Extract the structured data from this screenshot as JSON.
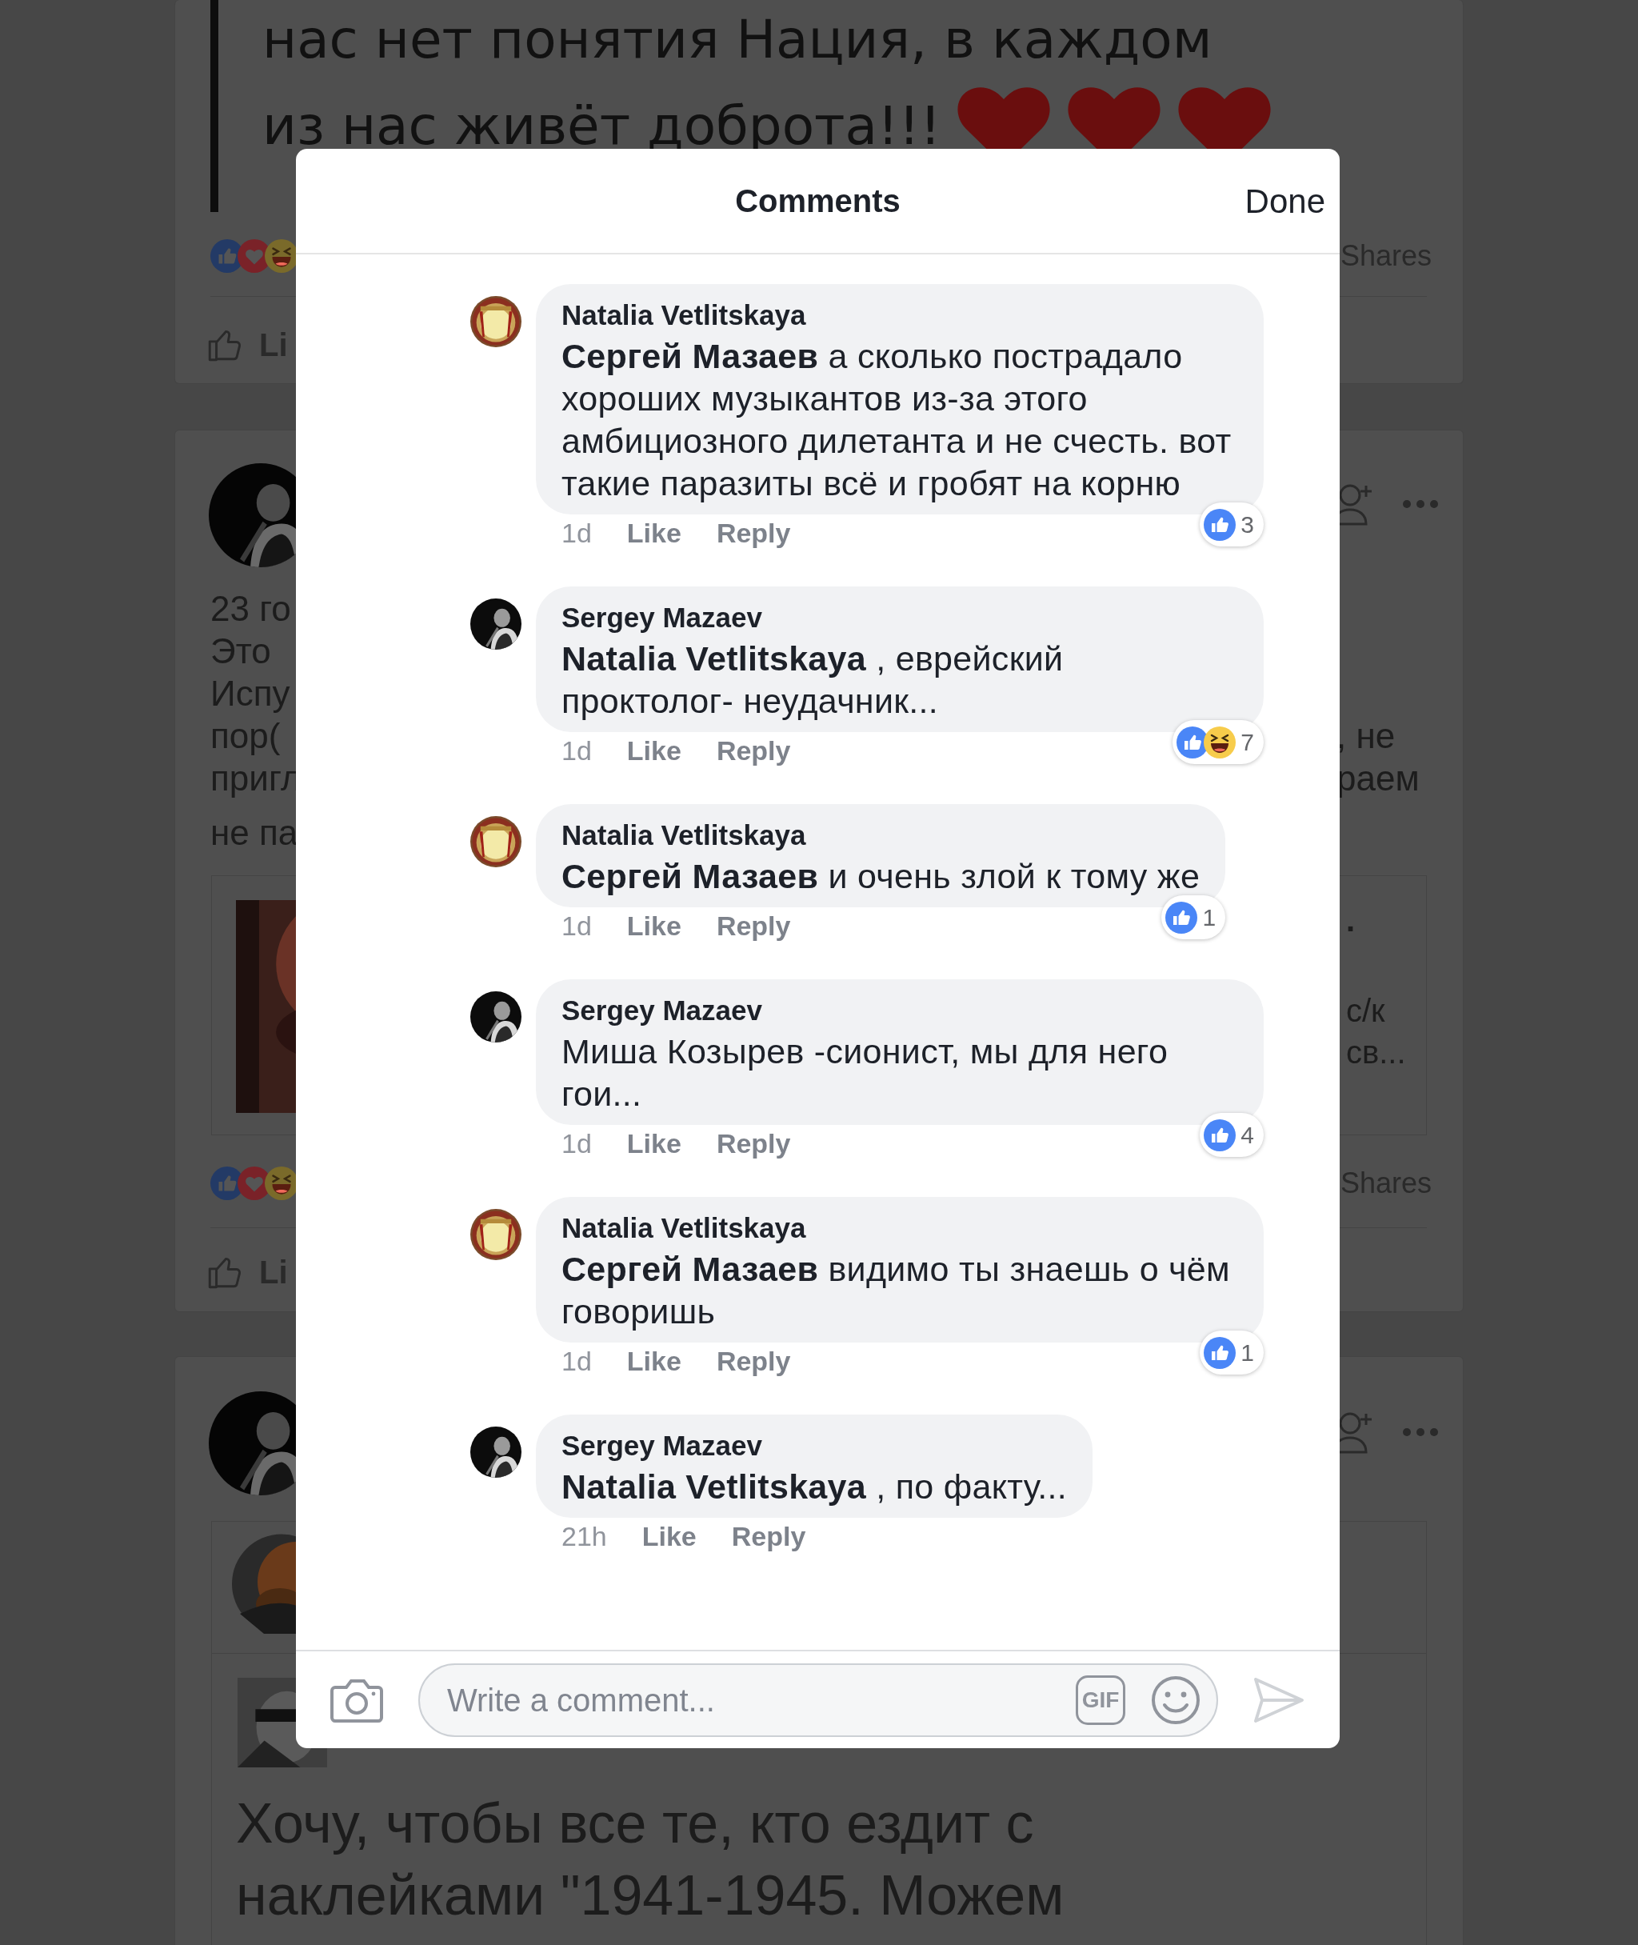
{
  "feed": {
    "posts": [
      {
        "kind": "image_text",
        "image_lines": [
          "нас нет понятия Нация, в каждом",
          "из нас живёт доброта!!!"
        ],
        "reactions": [
          {
            "kind": "like"
          },
          {
            "kind": "love"
          },
          {
            "kind": "haha"
          }
        ],
        "shares": "Shares",
        "like": "Li"
      },
      {
        "kind": "link",
        "lines": [
          {
            "left": "23 го"
          },
          {
            "left": "Это"
          },
          {
            "left": "Испу"
          },
          {
            "left": "пор(",
            "right": ", не"
          },
          {
            "left": "пригл",
            "right": "раем"
          }
        ],
        "last_line": "не па",
        "link_title": ".",
        "link_lines": [
          "с/к",
          "св..."
        ],
        "reactions": [
          {
            "kind": "like"
          },
          {
            "kind": "love"
          },
          {
            "kind": "haha"
          }
        ],
        "shares": "Shares",
        "like": "Li"
      },
      {
        "kind": "shared",
        "shared_text": "Хочу, чтобы все те, кто ездит с наклейками \"1941-1945. Можем"
      }
    ]
  },
  "dialog": {
    "title": "Comments",
    "done": "Done",
    "comments": [
      {
        "author": "Natalia Vetlitskaya",
        "text": "**Сергей Мазаев** а сколько пострадало хороших музыкантов из-за этого амбициозного дилетанта  и не счесть. вот такие паразиты всё и гробят на корню",
        "time": "1d",
        "like": "Like",
        "reply": "Reply",
        "reactions": [
          {
            "kind": "like"
          }
        ],
        "reaction_count": "3"
      },
      {
        "author": "Sergey Mazaev",
        "text": "**Natalia Vetlitskaya** , еврейский проктолог- неудачник...",
        "time": "1d",
        "like": "Like",
        "reply": "Reply",
        "reactions": [
          {
            "kind": "like"
          },
          {
            "kind": "haha"
          }
        ],
        "reaction_count": "7"
      },
      {
        "author": "Natalia Vetlitskaya",
        "text": "**Сергей Мазаев** и очень злой к тому же",
        "time": "1d",
        "like": "Like",
        "reply": "Reply",
        "reactions": [
          {
            "kind": "like"
          }
        ],
        "reaction_count": "1"
      },
      {
        "author": "Sergey Mazaev",
        "text": "Миша Козырев -сионист, мы для него гои...",
        "time": "1d",
        "like": "Like",
        "reply": "Reply",
        "reactions": [
          {
            "kind": "like"
          }
        ],
        "reaction_count": "4"
      },
      {
        "author": "Natalia Vetlitskaya",
        "text": "**Сергей Мазаев** видимо ты знаешь о чём говоришь",
        "time": "1d",
        "like": "Like",
        "reply": "Reply",
        "reactions": [
          {
            "kind": "like"
          }
        ],
        "reaction_count": "1"
      },
      {
        "author": "Sergey Mazaev",
        "text": "**Natalia Vetlitskaya** , по факту...",
        "time": "21h",
        "like": "Like",
        "reply": "Reply"
      }
    ],
    "composer": {
      "placeholder": "Write a comment...",
      "gif": "GIF"
    }
  }
}
